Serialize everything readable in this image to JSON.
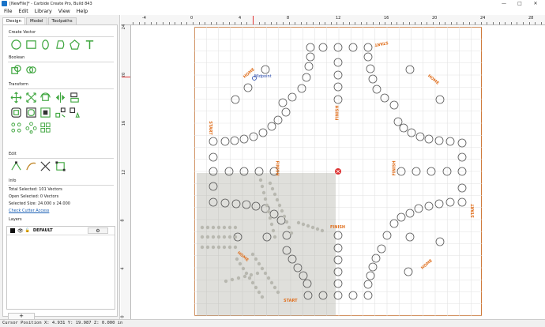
{
  "window": {
    "title": "[NewFile]* - Carbide Create Pro, Build 843"
  },
  "menu": [
    "File",
    "Edit",
    "Library",
    "View",
    "Help"
  ],
  "tabs": [
    {
      "label": "Design",
      "active": true
    },
    {
      "label": "Model",
      "active": false
    },
    {
      "label": "Toolpaths",
      "active": false
    }
  ],
  "sections": {
    "create_vector": "Create Vector",
    "boolean": "Boolean",
    "transform": "Transform",
    "edit": "Edit",
    "info": "Info",
    "layers": "Layers"
  },
  "info": {
    "total_selected": "Total Selected:",
    "total_selected_value": "101 Vectors",
    "open_selected": "Open Selected:",
    "open_selected_value": "0 Vectors",
    "selected_size": "Selected Size:",
    "selected_size_value": "24.000 x 24.000",
    "check_cutter": "Check Cutter Access"
  },
  "layers": [
    {
      "name": "DEFAULT",
      "color": "#111111"
    }
  ],
  "add_layer_label": "+",
  "ruler": {
    "x_labels": [
      "-4",
      "0",
      "4",
      "8",
      "12",
      "16",
      "20",
      "24",
      "28"
    ],
    "y_labels": [
      "24",
      "20",
      "16",
      "12",
      "8",
      "4",
      "0"
    ]
  },
  "canvas": {
    "midpoint_label": "Midpoint",
    "path_color": "#e0701f",
    "labels": {
      "start": "START",
      "home": "HOME",
      "finish": "FINISH"
    }
  },
  "status": {
    "cursor": "Cursor Position X: 4.931 Y: 19.987 Z: 0.000 in"
  }
}
